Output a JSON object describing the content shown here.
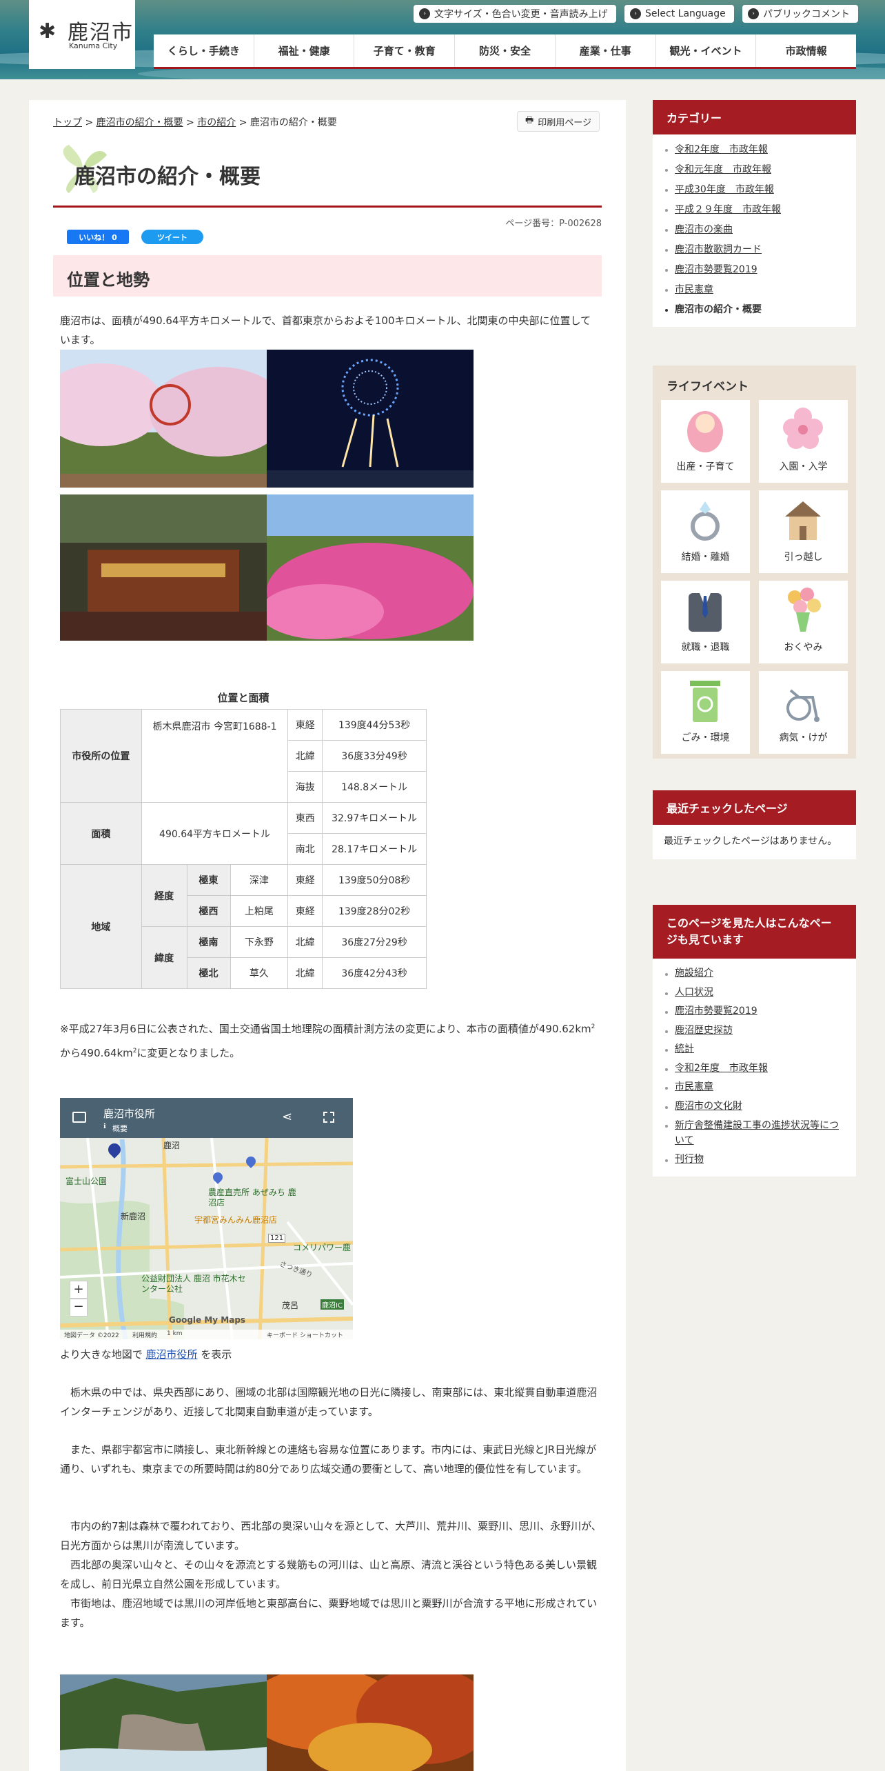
{
  "header": {
    "logo_jp": "鹿沼市",
    "logo_en": "Kanuma City",
    "utility": [
      {
        "label": "文字サイズ・色合い変更・音声読み上げ"
      },
      {
        "label": "Select Language"
      },
      {
        "label": "パブリックコメント"
      }
    ],
    "nav": [
      "くらし・手続き",
      "福祉・健康",
      "子育て・教育",
      "防災・安全",
      "産業・仕事",
      "観光・イベント",
      "市政情報"
    ]
  },
  "breadcrumb": {
    "items": [
      "トップ",
      "鹿沼市の紹介・概要",
      "市の紹介"
    ],
    "current": "鹿沼市の紹介・概要",
    "sep": " > "
  },
  "print_label": "印刷用ページ",
  "page_title": "鹿沼市の紹介・概要",
  "page_number": "ページ番号：P-002628",
  "social": {
    "like": "いいね！ 0",
    "tweet": "ツイート"
  },
  "section_heading": "位置と地勢",
  "intro": "鹿沼市は、面積が490.64平方キロメートルで、首都東京からおよそ100キロメートル、北関東の中央部に位置しています。",
  "table": {
    "caption": "位置と面積",
    "office_label": "市役所の位置",
    "office_address": "栃木県鹿沼市 今宮町1688-1",
    "office_rows": [
      {
        "k": "東経",
        "v": "139度44分53秒"
      },
      {
        "k": "北緯",
        "v": "36度33分49秒"
      },
      {
        "k": "海抜",
        "v": "148.8メートル"
      }
    ],
    "area_label": "面積",
    "area_value": "490.64平方キロメートル",
    "area_rows": [
      {
        "k": "東西",
        "v": "32.97キロメートル"
      },
      {
        "k": "南北",
        "v": "28.17キロメートル"
      }
    ],
    "region_label": "地域",
    "longitude_label": "経度",
    "latitude_label": "緯度",
    "extremes": [
      {
        "dir": "極東",
        "place": "深津",
        "k": "東経",
        "v": "139度50分08秒"
      },
      {
        "dir": "極西",
        "place": "上粕尾",
        "k": "東経",
        "v": "139度28分02秒"
      },
      {
        "dir": "極南",
        "place": "下永野",
        "k": "北緯",
        "v": "36度27分29秒"
      },
      {
        "dir": "極北",
        "place": "草久",
        "k": "北緯",
        "v": "36度42分43秒"
      }
    ]
  },
  "note": {
    "a": "※平成27年3月6日に公表された、国土交通省国土地理院の面積計測方法の変更により、本市の面積値が",
    "b": "490.62km",
    "c": "から490.64km",
    "d": "に変更となりました。",
    "sup": "2"
  },
  "map": {
    "title": "鹿沼市役所",
    "subtitle": "概要",
    "labels": {
      "park": "富士山公園",
      "station": "新鹿沼",
      "market": "農産直売所 あぜみち 鹿沼店",
      "gyoza": "宇都宮みんみん鹿沼店",
      "komeri": "コメリパワー鹿",
      "center": "公益財団法人 鹿沼 市花木センター公社",
      "kanuma": "鹿沼",
      "shigeo": "茂呂",
      "ic": "鹿沼IC",
      "route": "121",
      "satsuki": "さつき通り"
    },
    "attribution": "地図データ ©2022",
    "terms": "利用規約",
    "scale": "1 km",
    "shortcuts": "キーボード ショートカット",
    "google": "Google My Maps"
  },
  "map_caption": {
    "before": "より大きな地図で ",
    "link": "鹿沼市役所",
    "after": " を表示"
  },
  "paragraphs": [
    "　栃木県の中では、県央西部にあり、圏域の北部は国際観光地の日光に隣接し、南東部には、東北縦貫自動車道鹿沼インターチェンジがあり、近接して北関東自動車道が走っています。",
    "　また、県都宇都宮市に隣接し、東北新幹線との連絡も容易な位置にあります。市内には、東武日光線とJR日光線が通り、いずれも、東京までの所要時間は約80分であり広域交通の要衝として、高い地理的優位性を有しています。",
    "　市内の約7割は森林で覆われており、西北部の奥深い山々を源として、大芦川、荒井川、粟野川、思川、永野川が、日光方面からは黒川が南流しています。",
    "　西北部の奥深い山々と、その山々を源流とする幾筋もの河川は、山と高原、清流と渓谷という特色ある美しい景観を成し、前日光県立自然公園を形成しています。",
    "　市街地は、鹿沼地域では黒川の河岸低地と東部高台に、粟野地域では思川と粟野川が合流する平地に形成されています。"
  ],
  "sidebar": {
    "category": {
      "title": "カテゴリー",
      "items": [
        "令和2年度　市政年報",
        "令和元年度　市政年報",
        "平成30年度　市政年報",
        "平成２９年度　市政年報",
        "鹿沼市の楽曲",
        "鹿沼市散歌詞カード",
        "鹿沼市勢要覧2019",
        "市民憲章",
        "鹿沼市の紹介・概要"
      ]
    },
    "life": {
      "title": "ライフイベント",
      "items": [
        "出産・子育て",
        "入園・入学",
        "結婚・離婚",
        "引っ越し",
        "就職・退職",
        "おくやみ",
        "ごみ・環境",
        "病気・けが"
      ]
    },
    "recent": {
      "title": "最近チェックしたページ",
      "empty": "最近チェックしたページはありません。"
    },
    "related": {
      "title": "このページを見た人はこんなページも見ています",
      "items": [
        "施設紹介",
        "人口状況",
        "鹿沼市勢要覧2019",
        "鹿沼歴史探訪",
        "統計",
        "令和2年度　市政年報",
        "市民憲章",
        "鹿沼市の文化財",
        "新庁舎整備建設工事の進捗状況等について",
        "刊行物"
      ]
    }
  },
  "colors": {
    "accent": "#a51d23",
    "section_bg": "#fde7e8",
    "link": "#1a4fb5"
  }
}
